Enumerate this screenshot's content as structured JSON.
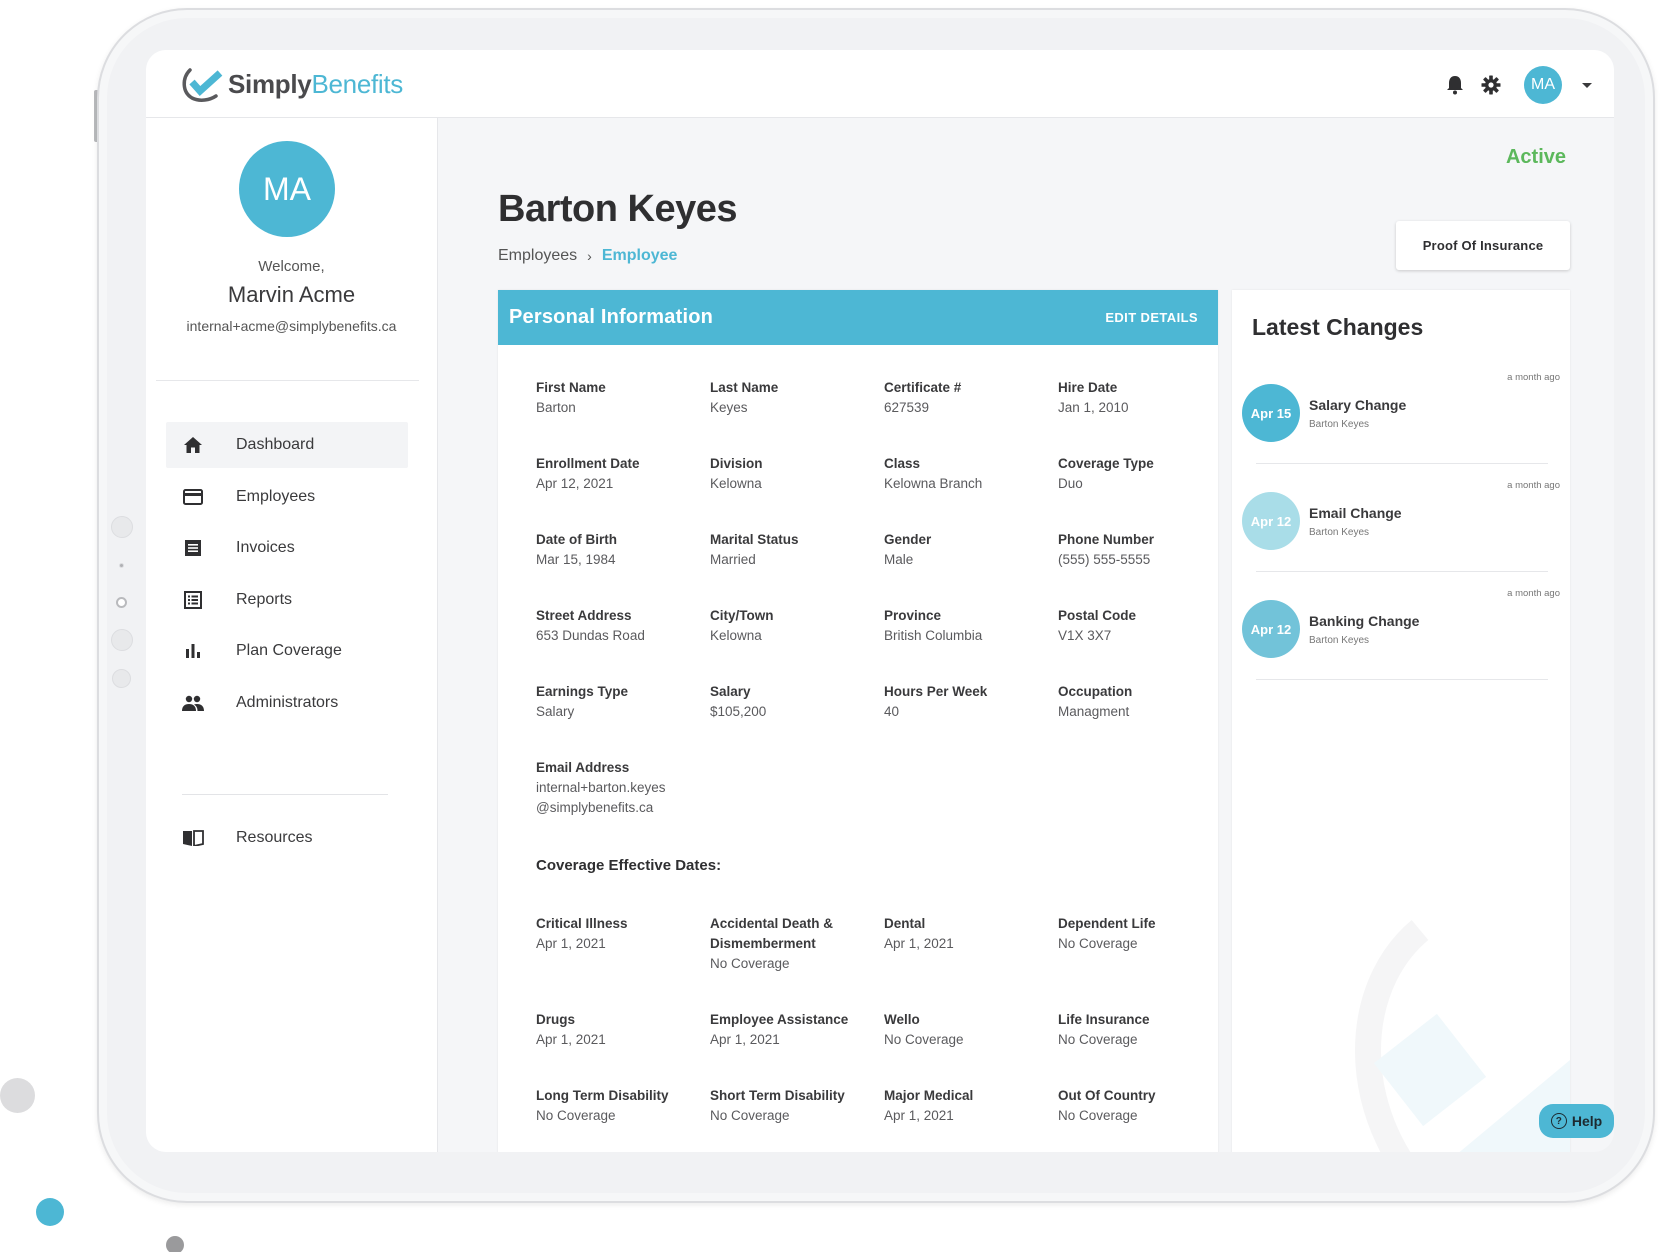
{
  "app": {
    "brand_part1": "Simply",
    "brand_part2": "Benefits",
    "accent_color": "#4db7d4",
    "status_color": "#5cb85c"
  },
  "topbar": {
    "icons": [
      "bell-icon",
      "gear-icon"
    ],
    "avatar_initials": "MA"
  },
  "sidebar": {
    "avatar_initials": "MA",
    "welcome": "Welcome,",
    "user_name": "Marvin Acme",
    "user_email": "internal+acme@simplybenefits.ca",
    "items": [
      {
        "label": "Dashboard",
        "icon": "home-icon",
        "active": true
      },
      {
        "label": "Employees",
        "icon": "credit-card-icon",
        "active": false
      },
      {
        "label": "Invoices",
        "icon": "receipt-icon",
        "active": false
      },
      {
        "label": "Reports",
        "icon": "list-alt-icon",
        "active": false
      },
      {
        "label": "Plan Coverage",
        "icon": "bar-chart-icon",
        "active": false
      },
      {
        "label": "Administrators",
        "icon": "people-icon",
        "active": false
      }
    ],
    "resources": {
      "label": "Resources",
      "icon": "book-icon"
    }
  },
  "main": {
    "status": "Active",
    "title": "Barton Keyes",
    "breadcrumb": {
      "parent": "Employees",
      "separator": "›",
      "current": "Employee"
    },
    "proof_of_insurance_label": "Proof Of Insurance",
    "personal_info": {
      "title": "Personal Information",
      "edit_label": "EDIT DETAILS",
      "fields": [
        {
          "label": "First Name",
          "value": "Barton"
        },
        {
          "label": "Last Name",
          "value": "Keyes"
        },
        {
          "label": "Certificate #",
          "value": "627539"
        },
        {
          "label": "Hire Date",
          "value": "Jan 1, 2010"
        },
        {
          "label": "Enrollment Date",
          "value": "Apr 12, 2021"
        },
        {
          "label": "Division",
          "value": "Kelowna"
        },
        {
          "label": "Class",
          "value": "Kelowna Branch"
        },
        {
          "label": "Coverage Type",
          "value": "Duo"
        },
        {
          "label": "Date of Birth",
          "value": "Mar 15, 1984"
        },
        {
          "label": "Marital Status",
          "value": "Married"
        },
        {
          "label": "Gender",
          "value": "Male"
        },
        {
          "label": "Phone Number",
          "value": "(555) 555-5555"
        },
        {
          "label": "Street Address",
          "value": "653 Dundas Road"
        },
        {
          "label": "City/Town",
          "value": "Kelowna"
        },
        {
          "label": "Province",
          "value": "British Columbia"
        },
        {
          "label": "Postal Code",
          "value": "V1X 3X7"
        },
        {
          "label": "Earnings Type",
          "value": "Salary"
        },
        {
          "label": "Salary",
          "value": "$105,200"
        },
        {
          "label": "Hours Per Week",
          "value": "40"
        },
        {
          "label": "Occupation",
          "value": "Managment"
        }
      ],
      "email": {
        "label": "Email Address",
        "value_line1": "internal+barton.keyes",
        "value_line2": "@simplybenefits.ca"
      },
      "coverage_title": "Coverage Effective Dates:",
      "coverage": [
        {
          "label": "Critical Illness",
          "value": "Apr 1, 2021"
        },
        {
          "label": "Accidental Death & Dismemberment",
          "value": "No Coverage"
        },
        {
          "label": "Dental",
          "value": "Apr 1, 2021"
        },
        {
          "label": "Dependent Life",
          "value": "No Coverage"
        },
        {
          "label": "Drugs",
          "value": "Apr 1, 2021"
        },
        {
          "label": "Employee Assistance",
          "value": "Apr 1, 2021"
        },
        {
          "label": "Wello",
          "value": "No Coverage"
        },
        {
          "label": "Life Insurance",
          "value": "No Coverage"
        },
        {
          "label": "Long Term Disability",
          "value": "No Coverage"
        },
        {
          "label": "Short Term Disability",
          "value": "No Coverage"
        },
        {
          "label": "Major Medical",
          "value": "Apr 1, 2021"
        },
        {
          "label": "Out Of Country",
          "value": "No Coverage"
        }
      ]
    },
    "latest_changes": {
      "title": "Latest Changes",
      "items": [
        {
          "date": "Apr 15",
          "title": "Salary Change",
          "subtitle": "Barton Keyes",
          "time": "a month ago",
          "color": "#4db7d4"
        },
        {
          "date": "Apr 12",
          "title": "Email Change",
          "subtitle": "Barton Keyes",
          "time": "a month ago",
          "color": "#a9dde8"
        },
        {
          "date": "Apr 12",
          "title": "Banking Change",
          "subtitle": "Barton Keyes",
          "time": "a month ago",
          "color": "#72c3d9"
        }
      ]
    },
    "help_label": "Help"
  }
}
